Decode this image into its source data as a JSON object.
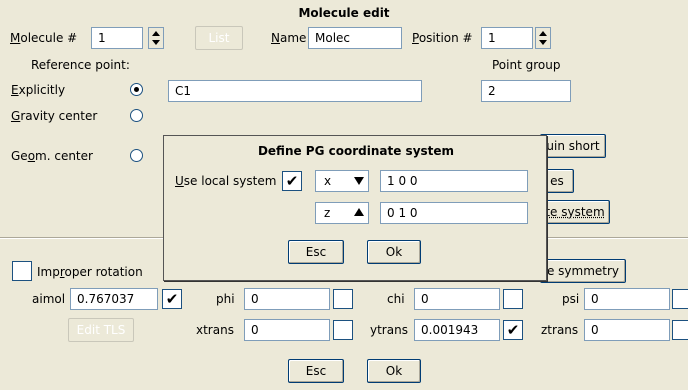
{
  "window": {
    "title": "Molecule edit"
  },
  "molecule": {
    "label": "Molecule #",
    "value": "1",
    "list_button": "List",
    "name_label": "Name",
    "name_value": "Molec",
    "position_label": "Position #",
    "position_value": "1"
  },
  "reference": {
    "header": "Reference point:",
    "point_group_header": "Point group",
    "explicitly_label": "Explicitly",
    "explicitly_value": "C1",
    "point_group_value": "2",
    "gravity_label": "Gravity center",
    "geom_label": "Geom. center",
    "selected": "explicitly"
  },
  "right_buttons": {
    "quin_short": "uin short",
    "es": "es",
    "coord_system": "te system",
    "symmetry": "e symmetry"
  },
  "params": {
    "improper_rotation": "Improper rotation",
    "aimol_label": "aimol",
    "aimol_value": "0.767037",
    "phi_label": "phi",
    "phi_value": "0",
    "chi_label": "chi",
    "chi_value": "0",
    "psi_label": "psi",
    "psi_value": "0",
    "edit_tls": "Edit TLS",
    "xtrans_label": "xtrans",
    "xtrans_value": "0",
    "ytrans_label": "ytrans",
    "ytrans_value": "0.001943",
    "ztrans_label": "ztrans",
    "ztrans_value": "0"
  },
  "footer": {
    "esc": "Esc",
    "ok": "Ok"
  },
  "dialog": {
    "title": "Define PG coordinate system",
    "use_local_label": "Use local system",
    "use_local_checked": true,
    "axis1_select": "x",
    "axis1_value": "1 0 0",
    "axis2_select": "z",
    "axis2_value": "0 1 0",
    "esc": "Esc",
    "ok": "Ok"
  },
  "colors": {
    "background": "#ece9d8",
    "field_border": "#7f9db9"
  }
}
